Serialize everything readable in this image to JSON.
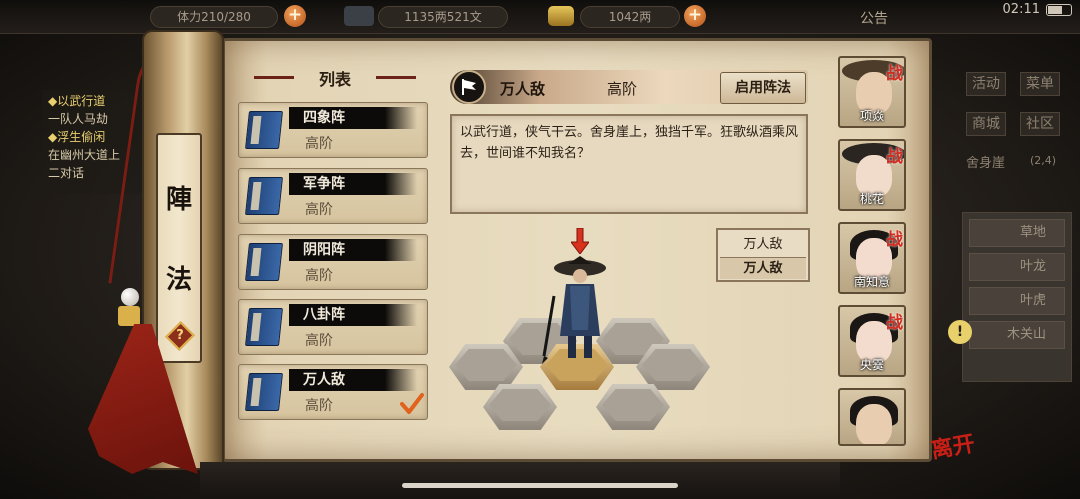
{
  "topbar": {
    "stamina": "体力210/280",
    "money": "1135两521文",
    "gold": "1042两",
    "notice": "公告",
    "time": "02:11"
  },
  "quest": {
    "lines": [
      "◆以武行道",
      "一队人马劫",
      "◆浮生偷闲",
      "在幽州大道上",
      "二对话"
    ]
  },
  "right_menu": {
    "buttons": [
      "活动",
      "菜单",
      "商城",
      "社区"
    ],
    "location": "舍身崖",
    "coords": "(2,4)",
    "places": [
      "草地",
      "叶龙",
      "叶虎",
      "木关山"
    ]
  },
  "panel": {
    "title_chars": [
      "陣",
      "法"
    ],
    "help_glyph": "?",
    "list_title": "列表"
  },
  "formations": [
    {
      "name": "四象阵",
      "tier": "高阶",
      "selected": false
    },
    {
      "name": "军争阵",
      "tier": "高阶",
      "selected": false
    },
    {
      "name": "阴阳阵",
      "tier": "高阶",
      "selected": false
    },
    {
      "name": "八卦阵",
      "tier": "高阶",
      "selected": false
    },
    {
      "name": "万人敌",
      "tier": "高阶",
      "selected": true
    }
  ],
  "detail": {
    "name": "万人敌",
    "tier": "高阶",
    "enable_label": "启用阵法",
    "description": "以武行道，侠气干云。舍身崖上，独挡千军。狂歌纵酒乘风去，世间谁不知我名？",
    "side_top": "万人敌",
    "side_bottom": "万人敌"
  },
  "characters": [
    {
      "name": "项焱",
      "badge": "战"
    },
    {
      "name": "桃花",
      "badge": "战"
    },
    {
      "name": "南知意",
      "badge": "战"
    },
    {
      "name": "央霙",
      "badge": "战"
    },
    {
      "name": "",
      "badge": ""
    }
  ],
  "leave_label": "离开",
  "colors": {
    "accent_red": "#c81f16",
    "parchment": "#e8dcc0",
    "plus_orange": "#d8702e"
  }
}
